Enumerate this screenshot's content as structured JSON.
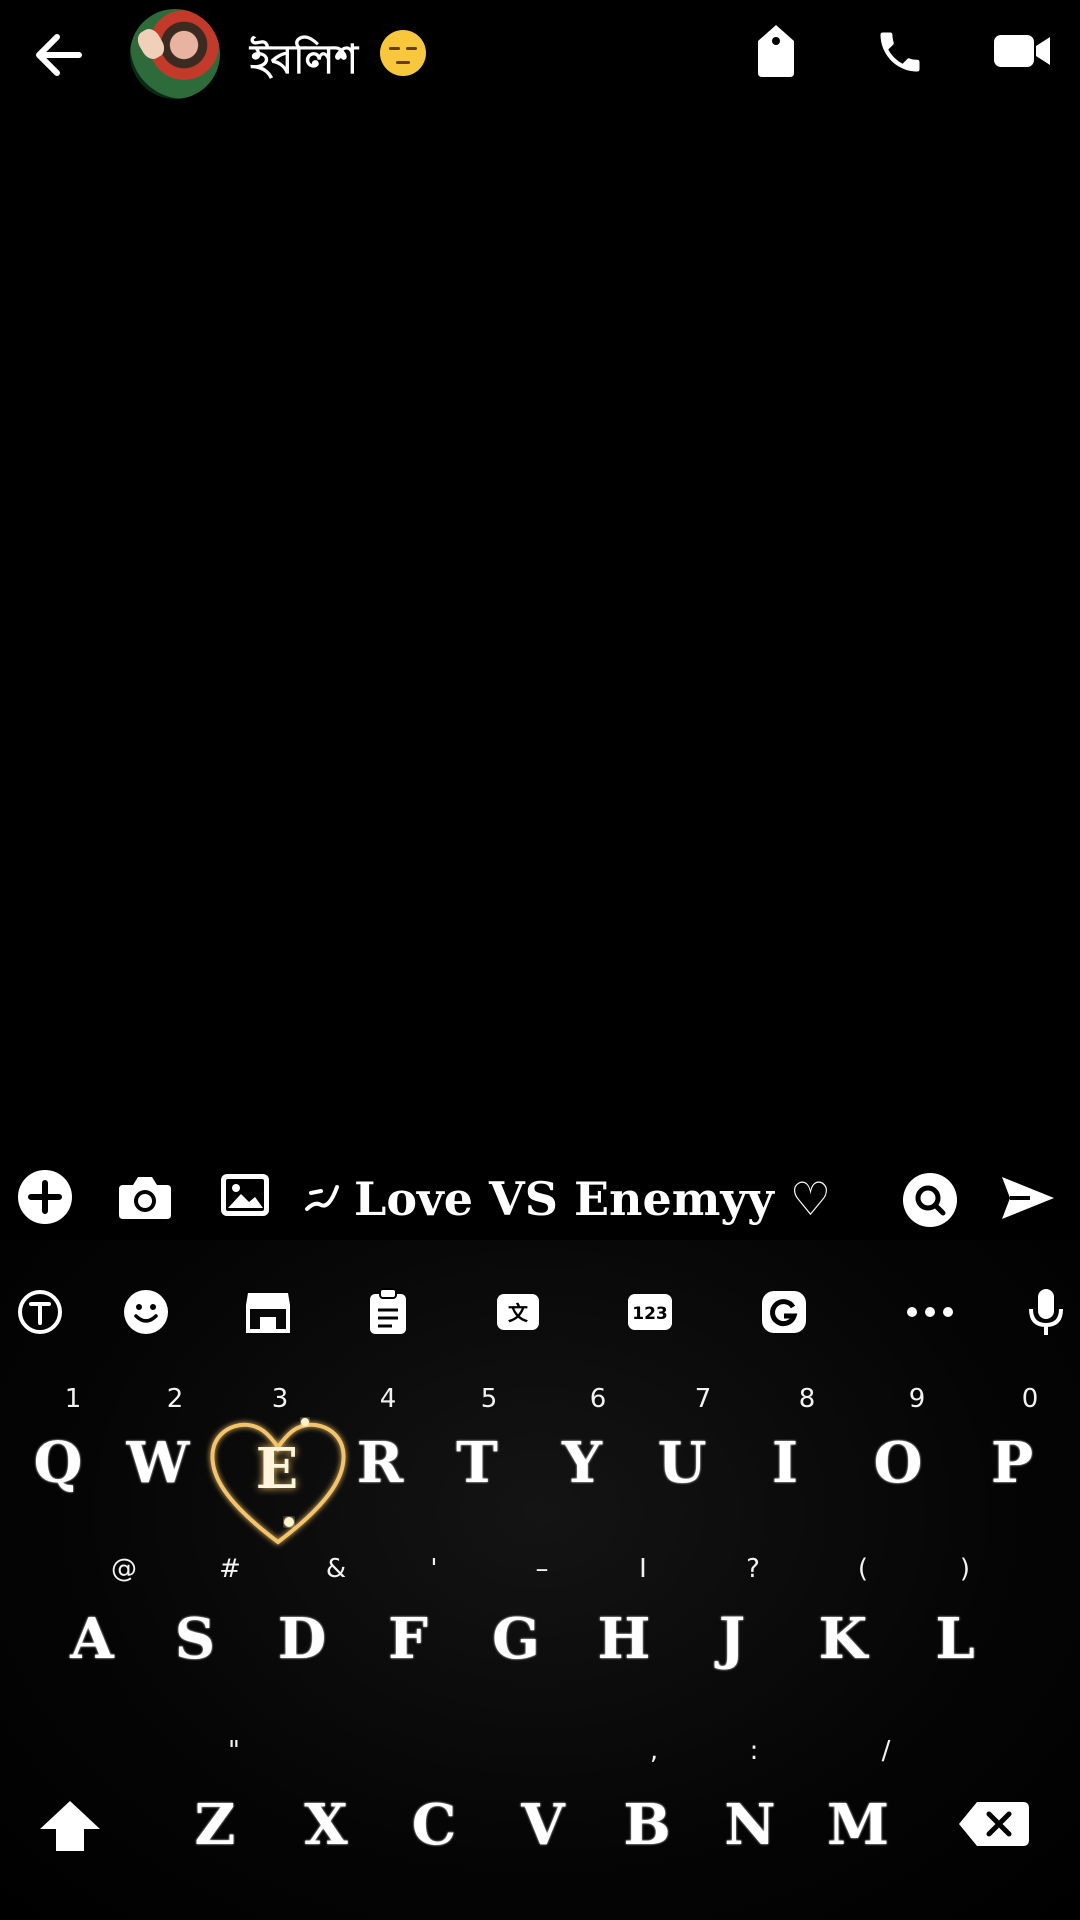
{
  "header": {
    "contact_name": "ইবলিশ",
    "emoji_icon": "unamused-face-icon"
  },
  "composer": {
    "text": "Love VS Enemyy ♡"
  },
  "keyboard": {
    "number_hints": [
      "1",
      "2",
      "3",
      "4",
      "5",
      "6",
      "7",
      "8",
      "9",
      "0"
    ],
    "row1": [
      "Q",
      "W",
      "E",
      "R",
      "T",
      "Y",
      "U",
      "I",
      "O",
      "P"
    ],
    "symbol_hints_row2": [
      "@",
      "#",
      "&",
      "'",
      "–",
      "I",
      "?",
      "(",
      ")"
    ],
    "row2": [
      "A",
      "S",
      "D",
      "F",
      "G",
      "H",
      "J",
      "K",
      "L"
    ],
    "symbol_hints_row3": [
      "\"",
      ",",
      ":",
      "/"
    ],
    "row3": [
      "Z",
      "X",
      "C",
      "V",
      "B",
      "N",
      "M"
    ]
  },
  "colors": {
    "background": "#000000",
    "foreground": "#ffffff",
    "heart_glow": "#f4c46a"
  }
}
